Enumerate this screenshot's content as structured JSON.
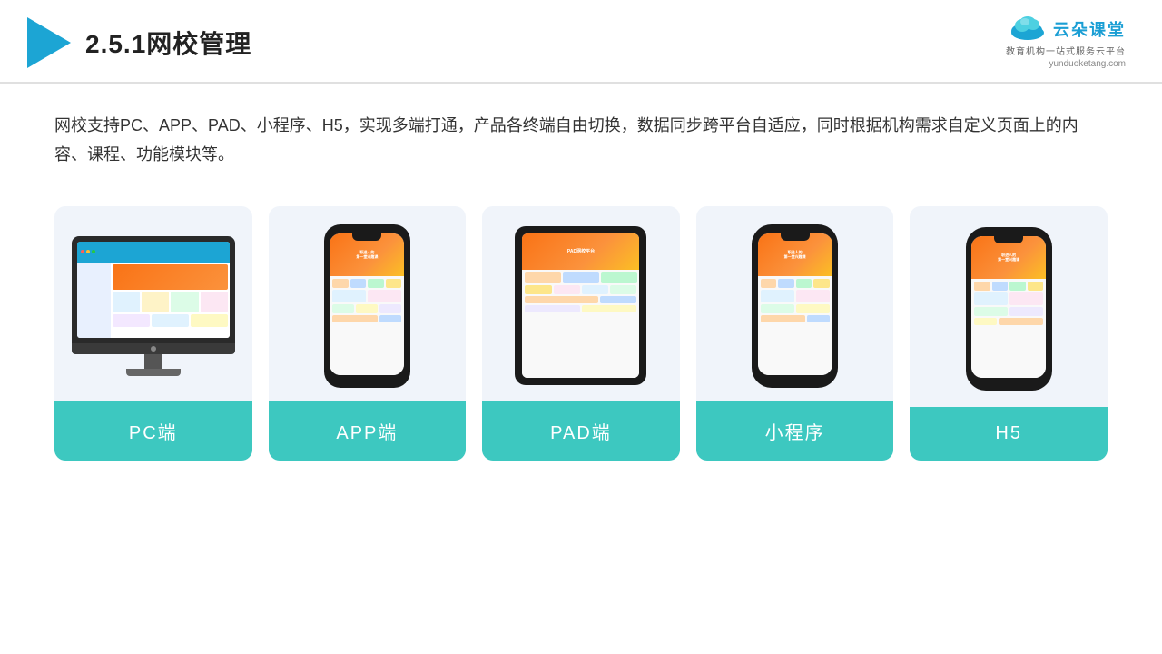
{
  "header": {
    "title": "2.5.1网校管理",
    "brand": {
      "name": "云朵课堂",
      "tagline": "教育机构一站式服务云平台",
      "url": "yunduoketang.com"
    }
  },
  "description": {
    "text": "网校支持PC、APP、PAD、小程序、H5，实现多端打通，产品各终端自由切换，数据同步跨平台自适应，同时根据机构需求自定义页面上的内容、课程、功能模块等。"
  },
  "cards": [
    {
      "id": "pc",
      "label": "PC端"
    },
    {
      "id": "app",
      "label": "APP端"
    },
    {
      "id": "pad",
      "label": "PAD端"
    },
    {
      "id": "miniprogram",
      "label": "小程序"
    },
    {
      "id": "h5",
      "label": "H5"
    }
  ],
  "colors": {
    "teal": "#3dc8c0",
    "blue": "#1ca5d4",
    "orange": "#f97316",
    "bg_card": "#f0f4fa"
  }
}
